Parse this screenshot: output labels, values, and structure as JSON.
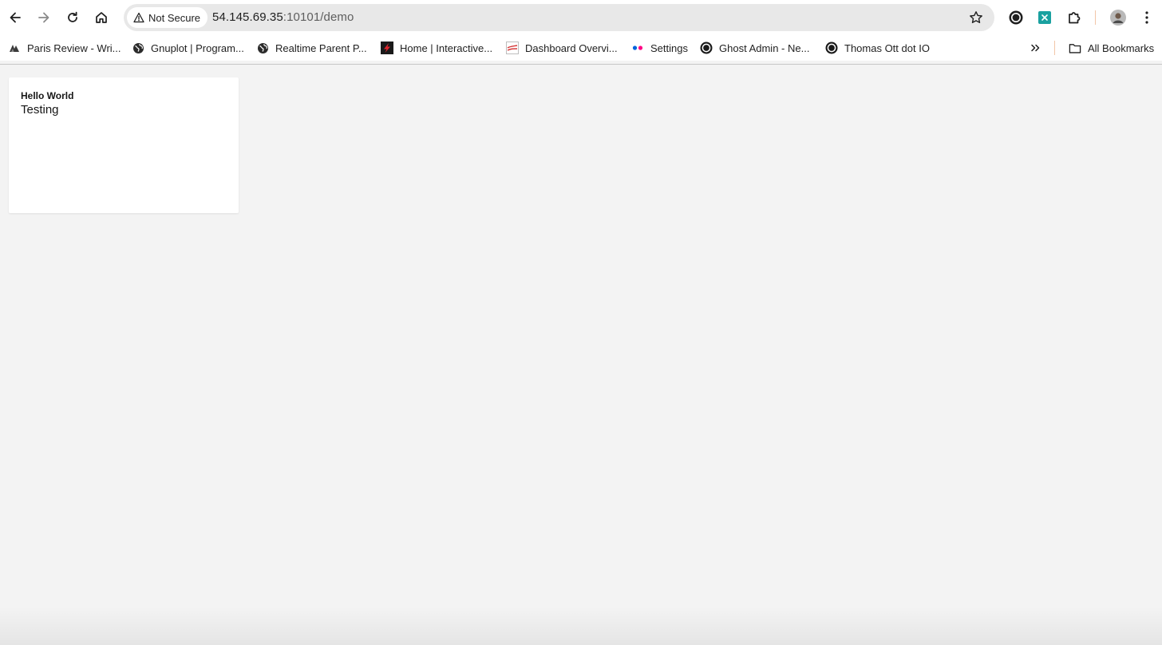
{
  "browser": {
    "security_label": "Not Secure",
    "url_host": "54.145.69.35",
    "url_rest": ":10101/demo"
  },
  "bookmarks": [
    {
      "label": "Paris Review - Wri...",
      "icon": "paris-review-icon"
    },
    {
      "label": "Gnuplot | Program...",
      "icon": "globe-icon"
    },
    {
      "label": "Realtime Parent P...",
      "icon": "globe-icon"
    },
    {
      "label": "Home | Interactive...",
      "icon": "red-brand-icon"
    },
    {
      "label": "Dashboard Overvi...",
      "icon": "dashboard-icon"
    },
    {
      "label": "Settings",
      "icon": "flickr-dots-icon"
    },
    {
      "label": "Ghost Admin - Ne...",
      "icon": "ghost-icon"
    },
    {
      "label": "Thomas Ott dot IO",
      "icon": "ghost-icon"
    }
  ],
  "all_bookmarks_label": "All Bookmarks",
  "card": {
    "title": "Hello World",
    "subtitle": "Testing"
  },
  "colors": {
    "page_background": "#f3f3f3",
    "omnibox": "#e8e8e8",
    "extension_teal": "#1aa1a0",
    "flickr_blue": "#0063dc",
    "flickr_pink": "#ff0084"
  }
}
